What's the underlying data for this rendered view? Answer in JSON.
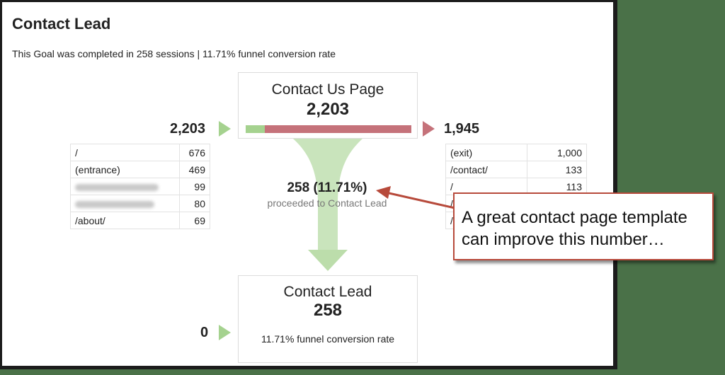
{
  "report": {
    "title": "Contact Lead",
    "summary": "This Goal was completed in 258 sessions | 11.71% funnel conversion rate"
  },
  "step1": {
    "name": "Contact Us Page",
    "count": "2,203",
    "entrances": "2,203",
    "exits": "1,945",
    "proceed_fraction": 0.1171
  },
  "entrance_sources": [
    {
      "label": "/",
      "value": "676",
      "blurred": false
    },
    {
      "label": "(entrance)",
      "value": "469",
      "blurred": false
    },
    {
      "label": "",
      "value": "99",
      "blurred": true
    },
    {
      "label": "",
      "value": "80",
      "blurred": true
    },
    {
      "label": "/about/",
      "value": "69",
      "blurred": false
    }
  ],
  "exit_destinations": [
    {
      "label": "(exit)",
      "value": "1,000"
    },
    {
      "label": "/contact/",
      "value": "133"
    },
    {
      "label": "/",
      "value": "113"
    },
    {
      "label": "/",
      "value": ""
    },
    {
      "label": "/",
      "value": ""
    }
  ],
  "proceed": {
    "count_text": "258 (11.71%)",
    "label": "proceeded to Contact Lead"
  },
  "step2": {
    "name": "Contact Lead",
    "count": "258",
    "entrances": "0",
    "rate_text": "11.71% funnel conversion rate"
  },
  "callout": {
    "line1": "A great contact page template",
    "line2": "can improve this number…"
  },
  "colors": {
    "proceed_green": "#a5d28f",
    "exit_red": "#c5727a",
    "callout_border": "#b74a3b",
    "background": "#4a7148"
  }
}
